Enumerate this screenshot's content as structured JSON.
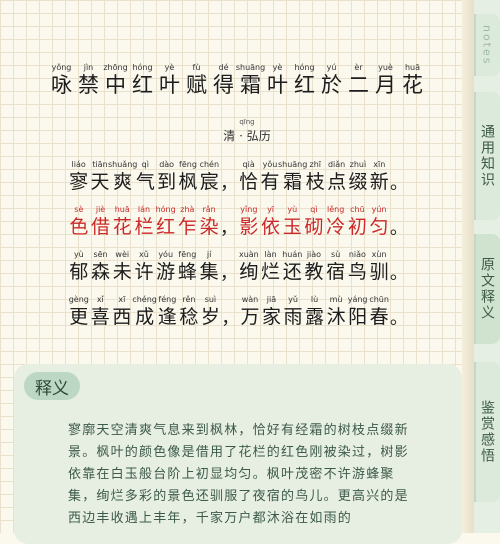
{
  "tabs": [
    {
      "label": "notes"
    },
    {
      "label": "通用知识"
    },
    {
      "label": "原文释义"
    },
    {
      "label": "鉴赏感悟"
    }
  ],
  "title": {
    "chars": [
      {
        "py": "yǒng",
        "hz": "咏"
      },
      {
        "py": "jìn",
        "hz": "禁"
      },
      {
        "py": "zhōng",
        "hz": "中"
      },
      {
        "py": "hóng",
        "hz": "红"
      },
      {
        "py": "yè",
        "hz": "叶"
      },
      {
        "py": "fù",
        "hz": "赋"
      },
      {
        "py": "dé",
        "hz": "得"
      },
      {
        "py": "shuāng",
        "hz": "霜"
      },
      {
        "py": "yè",
        "hz": "叶"
      },
      {
        "py": "hóng",
        "hz": "红"
      },
      {
        "py": "yú",
        "hz": "於"
      },
      {
        "py": "èr",
        "hz": "二"
      },
      {
        "py": "yuè",
        "hz": "月"
      },
      {
        "py": "huā",
        "hz": "花"
      }
    ]
  },
  "author": {
    "py": "qīng",
    "text": "清 · 弘历"
  },
  "poem": [
    {
      "highlight": false,
      "a": [
        [
          "liáo",
          "寥"
        ],
        [
          "tiān",
          "天"
        ],
        [
          "shuǎng",
          "爽"
        ],
        [
          "qì",
          "气"
        ],
        [
          "dào",
          "到"
        ],
        [
          "fēng",
          "枫"
        ],
        [
          "chén",
          "宸"
        ]
      ],
      "p1": "，",
      "b": [
        [
          "qià",
          "恰"
        ],
        [
          "yǒu",
          "有"
        ],
        [
          "shuāng",
          "霜"
        ],
        [
          "zhī",
          "枝"
        ],
        [
          "diǎn",
          "点"
        ],
        [
          "zhuì",
          "缀"
        ],
        [
          "xīn",
          "新"
        ]
      ],
      "p2": "。"
    },
    {
      "highlight": true,
      "a": [
        [
          "sè",
          "色"
        ],
        [
          "jiè",
          "借"
        ],
        [
          "huā",
          "花"
        ],
        [
          "lán",
          "栏"
        ],
        [
          "hóng",
          "红"
        ],
        [
          "zhà",
          "乍"
        ],
        [
          "rǎn",
          "染"
        ]
      ],
      "p1": "，",
      "b": [
        [
          "yǐng",
          "影"
        ],
        [
          "yī",
          "依"
        ],
        [
          "yù",
          "玉"
        ],
        [
          "qì",
          "砌"
        ],
        [
          "lěng",
          "冷"
        ],
        [
          "chū",
          "初"
        ],
        [
          "yún",
          "匀"
        ]
      ],
      "p2": "。"
    },
    {
      "highlight": false,
      "a": [
        [
          "yù",
          "郁"
        ],
        [
          "sēn",
          "森"
        ],
        [
          "wèi",
          "未"
        ],
        [
          "xǔ",
          "许"
        ],
        [
          "yóu",
          "游"
        ],
        [
          "fēng",
          "蜂"
        ],
        [
          "jí",
          "集"
        ]
      ],
      "p1": "，",
      "b": [
        [
          "xuàn",
          "绚"
        ],
        [
          "làn",
          "烂"
        ],
        [
          "huán",
          "还"
        ],
        [
          "jiào",
          "教"
        ],
        [
          "sù",
          "宿"
        ],
        [
          "niǎo",
          "鸟"
        ],
        [
          "xùn",
          "驯"
        ]
      ],
      "p2": "。"
    },
    {
      "highlight": false,
      "a": [
        [
          "gèng",
          "更"
        ],
        [
          "xǐ",
          "喜"
        ],
        [
          "xī",
          "西"
        ],
        [
          "chéng",
          "成"
        ],
        [
          "féng",
          "逢"
        ],
        [
          "rěn",
          "稔"
        ],
        [
          "suì",
          "岁"
        ]
      ],
      "p1": "，",
      "b": [
        [
          "wàn",
          "万"
        ],
        [
          "jiā",
          "家"
        ],
        [
          "yǔ",
          "雨"
        ],
        [
          "lù",
          "露"
        ],
        [
          "mù",
          "沐"
        ],
        [
          "yáng",
          "阳"
        ],
        [
          "chūn",
          "春"
        ]
      ],
      "p2": "。"
    }
  ],
  "explain": {
    "badge": "释义",
    "text": "寥廓天空清爽气息来到枫林，恰好有经霜的树枝点缀新景。枫叶的颜色像是借用了花栏的红色刚被染过，树影依靠在白玉般台阶上初显均匀。枫叶茂密不许游蜂聚集，绚烂多彩的景色还驯服了夜宿的鸟儿。更高兴的是西边丰收遇上丰年，千家万户都沐浴在如雨的"
  }
}
